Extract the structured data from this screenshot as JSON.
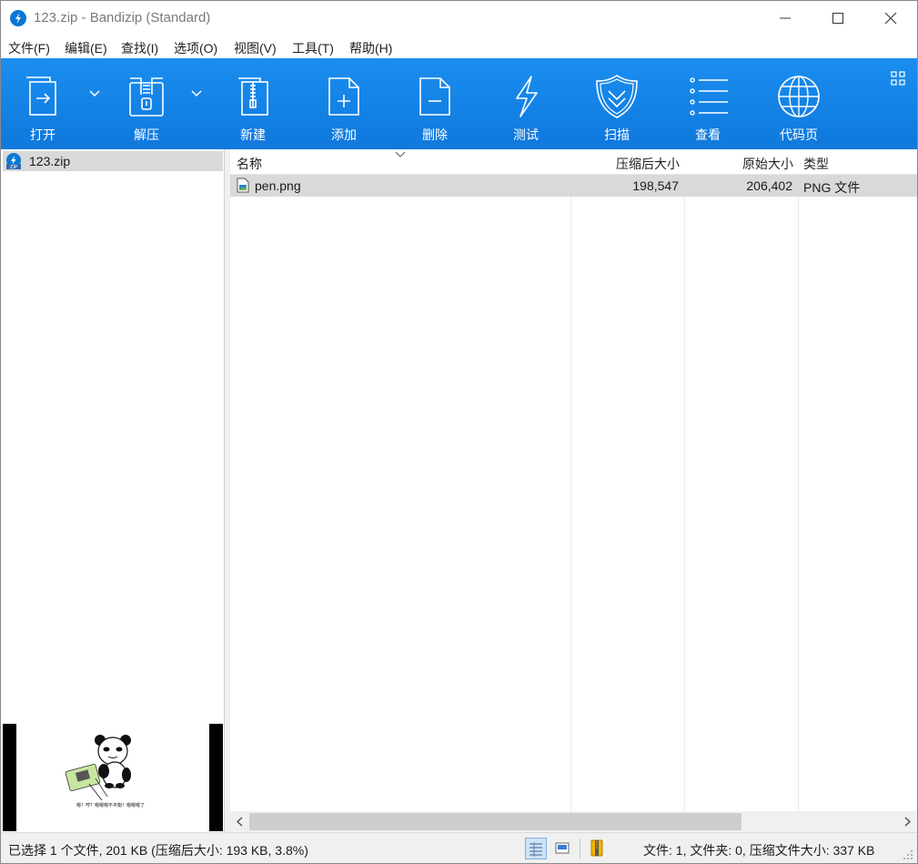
{
  "window": {
    "title": "123.zip - Bandizip (Standard)"
  },
  "menu": {
    "items": [
      "文件(F)",
      "编辑(E)",
      "查找(I)",
      "选项(O)",
      "视图(V)",
      "工具(T)",
      "帮助(H)"
    ]
  },
  "toolbar": {
    "buttons": [
      {
        "label": "打开",
        "icon": "open-icon"
      },
      {
        "label": "解压",
        "icon": "extract-icon"
      },
      {
        "label": "新建",
        "icon": "new-archive-icon"
      },
      {
        "label": "添加",
        "icon": "add-file-icon"
      },
      {
        "label": "删除",
        "icon": "delete-file-icon"
      },
      {
        "label": "测试",
        "icon": "test-lightning-icon"
      },
      {
        "label": "扫描",
        "icon": "scan-shield-icon"
      },
      {
        "label": "查看",
        "icon": "view-list-icon"
      },
      {
        "label": "代码页",
        "icon": "codepage-globe-icon"
      }
    ]
  },
  "tree": {
    "root": "123.zip"
  },
  "preview": {
    "caption": "嗯！哼？嗯嗯嗯不平衡！嗯嗯嗯了"
  },
  "list": {
    "columns": {
      "name": "名称",
      "compressed": "压缩后大小",
      "original": "原始大小",
      "type": "类型"
    },
    "rows": [
      {
        "name": "pen.png",
        "compressed": "198,547",
        "original": "206,402",
        "type": "PNG 文件"
      }
    ]
  },
  "status": {
    "left": "已选择 1 个文件, 201 KB (压缩后大小: 193 KB, 3.8%)",
    "right": "文件: 1, 文件夹: 0, 压缩文件大小: 337 KB"
  },
  "colors": {
    "toolbar": "#1a8ef0",
    "selection": "#d9d9d9",
    "accent": "#0a78d6"
  }
}
